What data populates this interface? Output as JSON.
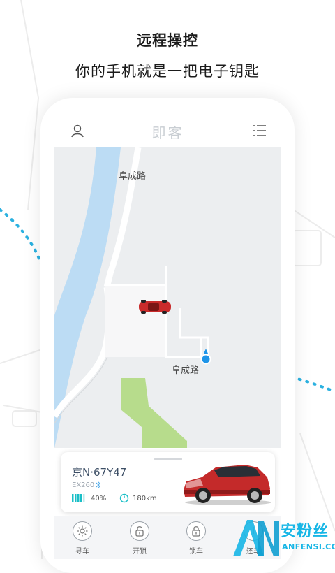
{
  "header": {
    "title": "远程操控",
    "subtitle": "你的手机就是一把电子钥匙"
  },
  "app": {
    "title": "即客"
  },
  "map": {
    "road_label_top": "阜成路",
    "road_label_bottom": "阜成路"
  },
  "vehicle": {
    "plate": "京N·67Y47",
    "model": "EX260",
    "battery": "40%",
    "range": "180km"
  },
  "bottom_bar": {
    "items": [
      {
        "label": "寻车",
        "icon": "sun-icon"
      },
      {
        "label": "开锁",
        "icon": "unlock-icon"
      },
      {
        "label": "锁车",
        "icon": "lock-icon"
      },
      {
        "label": "还车",
        "icon": "return-icon"
      }
    ]
  },
  "watermark": {
    "cn": "安粉丝",
    "en": "ANFENSI.COM"
  },
  "colors": {
    "river": "#bcdcf4",
    "park": "#b7dc8c",
    "accent_blue": "#1f95e8",
    "watermark": "#17b6e6"
  }
}
